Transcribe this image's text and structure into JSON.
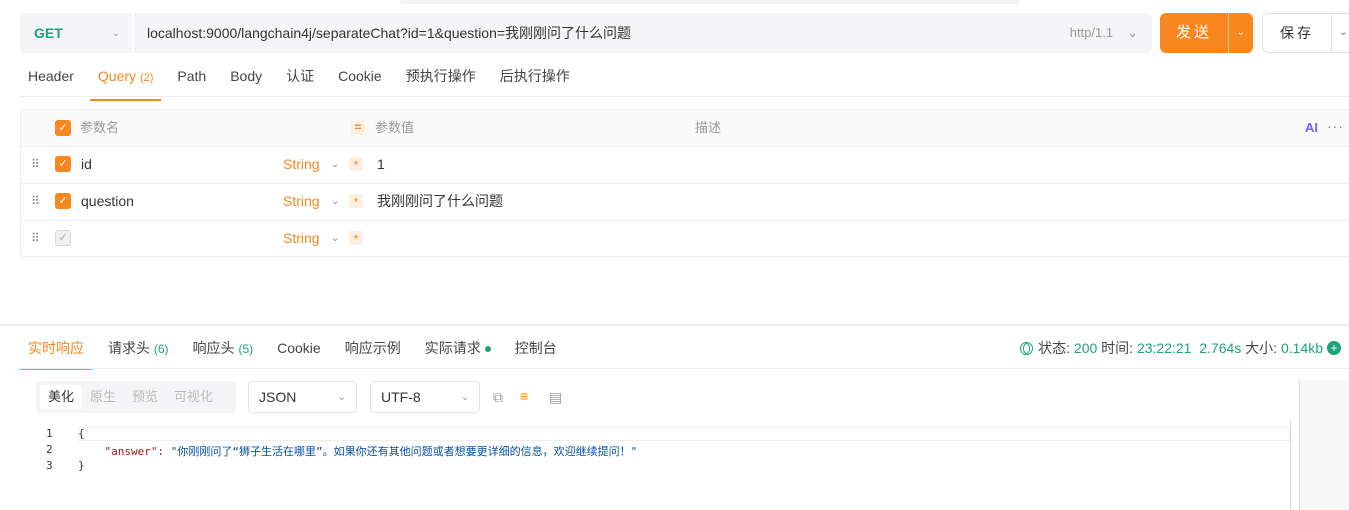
{
  "request": {
    "method": "GET",
    "url": "localhost:9000/langchain4j/separateChat?id=1&question=我刚刚问了什么问题",
    "protocol": "http/1.1",
    "send_label": "发送",
    "save_label": "保存"
  },
  "request_tabs": [
    {
      "label": "Header",
      "count": ""
    },
    {
      "label": "Query",
      "count": "(2)"
    },
    {
      "label": "Path",
      "count": ""
    },
    {
      "label": "Body",
      "count": ""
    },
    {
      "label": "认证",
      "count": ""
    },
    {
      "label": "Cookie",
      "count": ""
    },
    {
      "label": "预执行操作",
      "count": ""
    },
    {
      "label": "后执行操作",
      "count": ""
    }
  ],
  "params": {
    "header": {
      "name": "参数名",
      "value": "参数值",
      "desc": "描述",
      "ai": "AI"
    },
    "rows": [
      {
        "name": "id",
        "type": "String",
        "value": "1",
        "checked": true
      },
      {
        "name": "question",
        "type": "String",
        "value": "我刚刚问了什么问题",
        "checked": true
      },
      {
        "name": "",
        "type": "String",
        "value": "",
        "checked": false
      }
    ]
  },
  "response_tabs": [
    {
      "label": "实时响应",
      "count": ""
    },
    {
      "label": "请求头",
      "count": "(6)"
    },
    {
      "label": "响应头",
      "count": "(5)"
    },
    {
      "label": "Cookie",
      "count": ""
    },
    {
      "label": "响应示例",
      "count": ""
    },
    {
      "label": "实际请求",
      "count": ""
    },
    {
      "label": "控制台",
      "count": ""
    }
  ],
  "status": {
    "status_label": "状态:",
    "status_code": "200",
    "time_label": "时间:",
    "time": "23:22:21",
    "duration": "2.764s",
    "size_label": "大小:",
    "size": "0.14kb"
  },
  "view_modes": [
    "美化",
    "原生",
    "预览",
    "可视化"
  ],
  "format": "JSON",
  "encoding": "UTF-8",
  "code": {
    "line_numbers": [
      "1",
      "2",
      "3"
    ],
    "open": "{",
    "key": "\"answer\"",
    "colon": ": ",
    "value": "\"你刚刚问了“狮子生活在哪里”。如果你还有其他问题或者想要更详细的信息，欢迎继续提问！\"",
    "close": "}"
  }
}
